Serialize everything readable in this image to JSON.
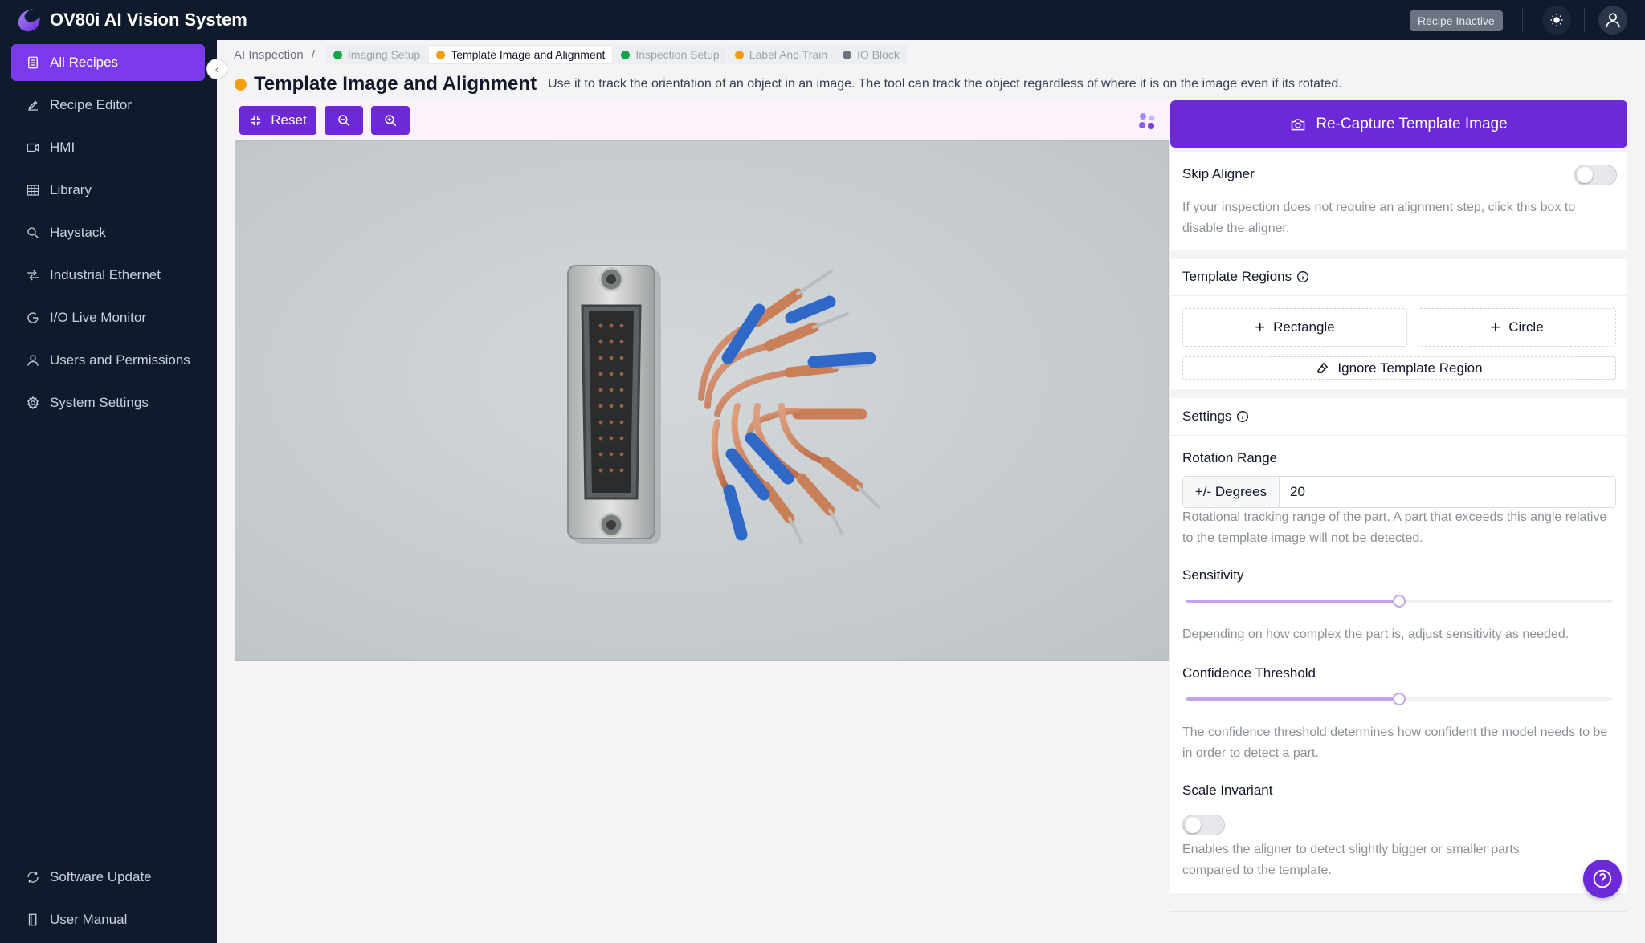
{
  "app": {
    "title": "OV80i AI Vision System",
    "recipe_status": "Recipe Inactive"
  },
  "sidebar": {
    "items": [
      {
        "label": "All Recipes",
        "icon": "document-list-icon",
        "active": true
      },
      {
        "label": "Recipe Editor",
        "icon": "pencil-icon"
      },
      {
        "label": "HMI",
        "icon": "video-icon"
      },
      {
        "label": "Library",
        "icon": "table-icon"
      },
      {
        "label": "Haystack",
        "icon": "search-icon"
      },
      {
        "label": "Industrial Ethernet",
        "icon": "network-icon"
      },
      {
        "label": "I/O Live Monitor",
        "icon": "monitor-icon"
      },
      {
        "label": "Users and Permissions",
        "icon": "user-icon"
      },
      {
        "label": "System Settings",
        "icon": "gear-icon"
      }
    ],
    "footer": [
      {
        "label": "Software Update",
        "icon": "refresh-icon"
      },
      {
        "label": "User Manual",
        "icon": "book-icon"
      }
    ]
  },
  "breadcrumb": {
    "root": "AI Inspection",
    "separator": "/",
    "steps": [
      {
        "label": "Imaging Setup",
        "status_color": "#16a34a"
      },
      {
        "label": "Template Image and Alignment",
        "status_color": "#f59e0b",
        "active": true
      },
      {
        "label": "Inspection Setup",
        "status_color": "#16a34a"
      },
      {
        "label": "Label And Train",
        "status_color": "#f59e0b"
      },
      {
        "label": "IO Block",
        "status_color": "#6b7280"
      }
    ]
  },
  "page": {
    "title": "Template Image and Alignment",
    "description": "Use it to track the orientation of an object in an image. The tool can track the object regardless of where it is on the image even if its rotated."
  },
  "toolbar": {
    "reset_label": "Reset"
  },
  "panel": {
    "recapture_label": "Re-Capture Template Image",
    "skip_aligner": {
      "label": "Skip Aligner",
      "enabled": false,
      "help": "If your inspection does not require an alignment step, click this box to disable the aligner."
    },
    "template_regions": {
      "label": "Template Regions",
      "rectangle_label": "Rectangle",
      "circle_label": "Circle",
      "ignore_label": "Ignore Template Region"
    },
    "settings": {
      "label": "Settings",
      "rotation": {
        "label": "Rotation Range",
        "addon": "+/- Degrees",
        "value": "20",
        "help": "Rotational tracking range of the part. A part that exceeds this angle relative to the template image will not be detected."
      },
      "sensitivity": {
        "label": "Sensitivity",
        "value": 0.5,
        "help": "Depending on how complex the part is, adjust sensitivity as needed."
      },
      "confidence": {
        "label": "Confidence Threshold",
        "value": 0.5,
        "help": "The confidence threshold determines how confident the model needs to be in order to detect a part."
      },
      "scale_invariant": {
        "label": "Scale Invariant",
        "enabled": false,
        "help": "Enables the aligner to detect slightly bigger or smaller parts compared to the template."
      }
    }
  },
  "colors": {
    "accent": "#6d28d9",
    "nav_bg": "#0f1a2c",
    "active_nav": "#7c3aed"
  }
}
